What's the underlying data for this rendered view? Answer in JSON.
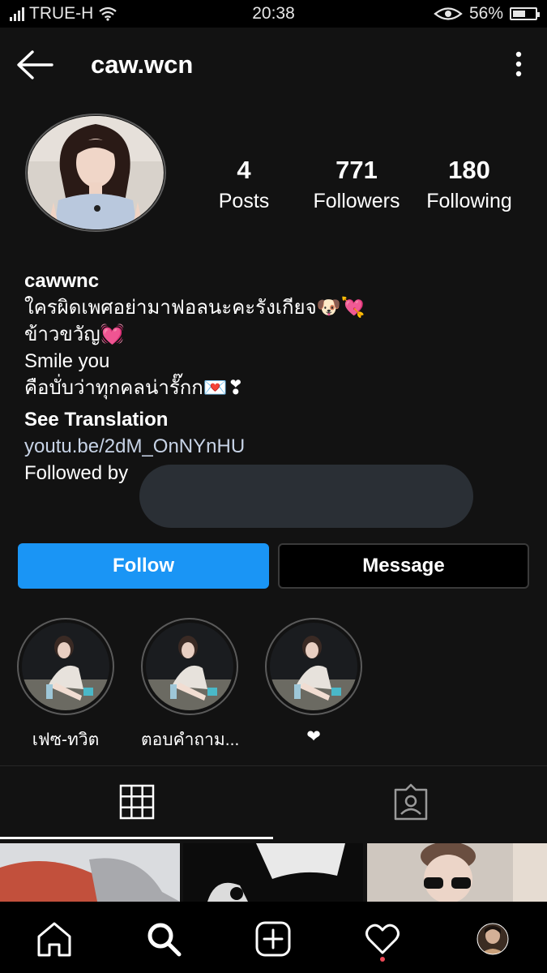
{
  "status_bar": {
    "carrier": "TRUE-H",
    "time": "20:38",
    "battery": "56%",
    "battery_level": 0.56
  },
  "header": {
    "username": "caw.wcn",
    "back_icon": "arrow-left-icon",
    "more_icon": "more-vertical-icon"
  },
  "profile": {
    "stats": {
      "posts": {
        "count": "4",
        "label": "Posts"
      },
      "followers": {
        "count": "771",
        "label": "Followers"
      },
      "following": {
        "count": "180",
        "label": "Following"
      }
    },
    "display_name": "cawwnc",
    "bio_lines": [
      "ใครผิดเพศอย่ามาฟอลนะคะรังเกียจ🐶💘",
      "ข้าวขวัญ💓",
      "Smile you",
      "คือบั่บว่าทุกคลน่ารั๊กก💌❣"
    ],
    "see_translation": "See Translation",
    "link": "youtu.be/2dM_OnNYnHU",
    "followed_by": "Followed by"
  },
  "actions": {
    "follow": "Follow",
    "message": "Message"
  },
  "highlights": [
    {
      "label": "เฟซ-ทวิต"
    },
    {
      "label": "ตอบคำถาม..."
    },
    {
      "label": "❤"
    }
  ],
  "tabs": {
    "active": "grid",
    "items": [
      "grid-icon",
      "tagged-icon"
    ]
  },
  "bottom_nav": [
    "home-icon",
    "search-icon",
    "add-post-icon",
    "heart-icon",
    "profile-avatar"
  ],
  "colors": {
    "background": "#121212",
    "follow_button": "#1a95f5",
    "notification_dot": "#ed4956"
  }
}
